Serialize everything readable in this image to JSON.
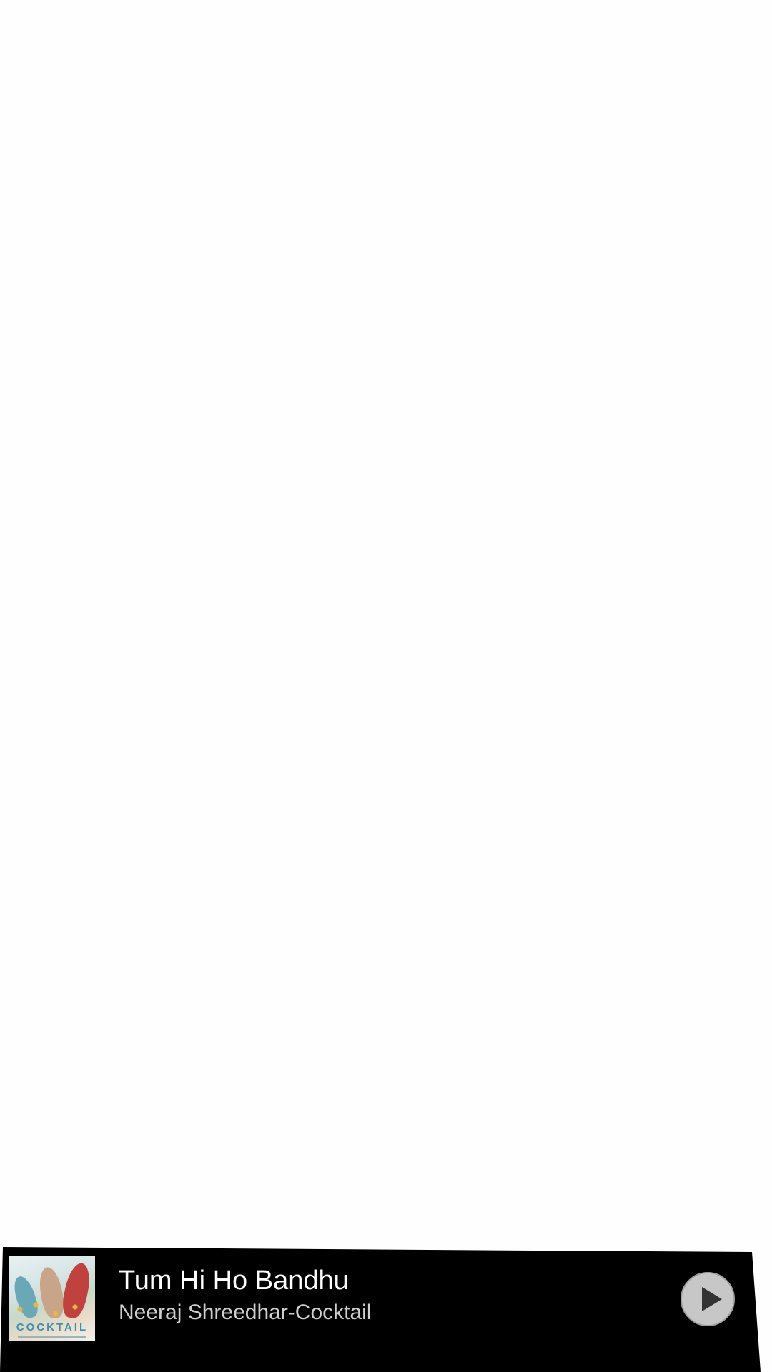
{
  "now_playing": {
    "title": "Tum Hi Ho Bandhu",
    "subtitle": "Neeraj Shreedhar-Cocktail",
    "album_art": {
      "name": "album-art",
      "text": "COCKTAIL"
    },
    "play_icon": "play-icon",
    "colors": {
      "bar_background": "#000000",
      "title": "#ffffff",
      "subtitle": "#cfcfcf",
      "play_button": "#c7c7c7"
    }
  }
}
